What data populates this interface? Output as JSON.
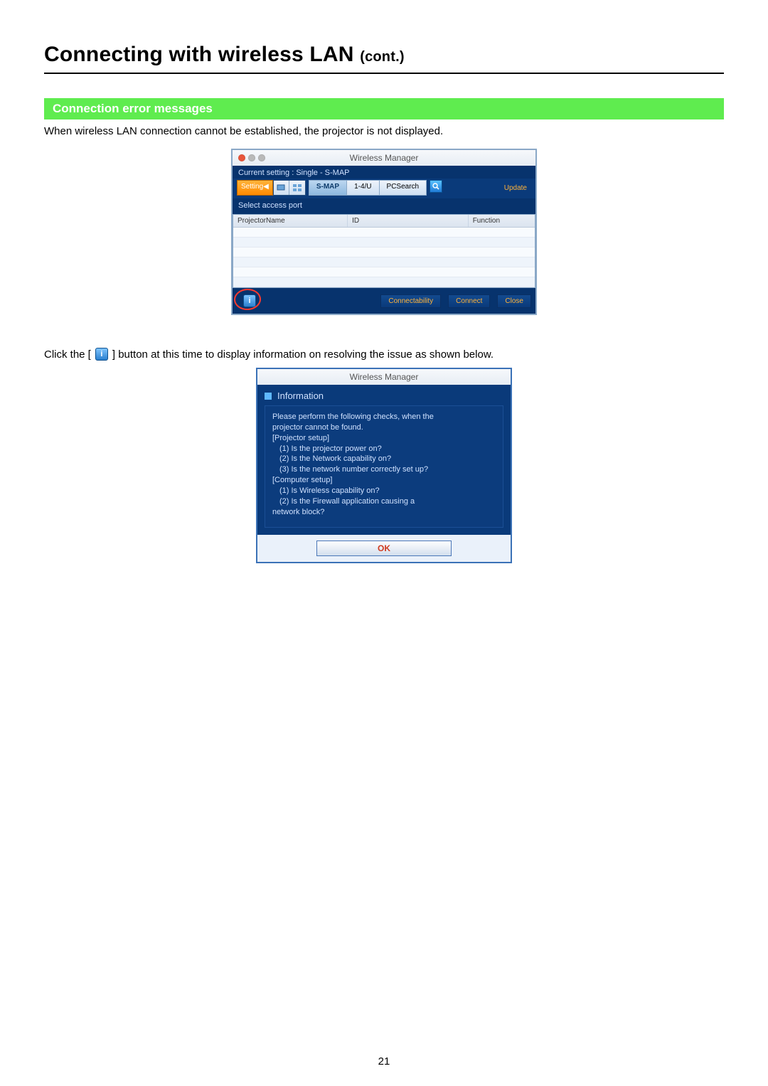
{
  "page": {
    "title_main": "Connecting with wireless LAN",
    "title_cont": "(cont.)",
    "section_header": "Connection error messages",
    "intro_text": "When wireless LAN connection cannot be established, the projector is not displayed.",
    "click_line_pre": "Click the [",
    "click_line_post": "] button at this time to display information on resolving the issue as shown below.",
    "page_number": "21"
  },
  "wm_window": {
    "title": "Wireless Manager",
    "current_setting": "Current setting : Single - S-MAP",
    "setting_btn": "Setting",
    "tabs": {
      "smap": "S-MAP",
      "one_four_u": "1-4/U",
      "pcsearch": "PCSearch"
    },
    "update": "Update",
    "select_access_port": "Select access port",
    "columns": {
      "name": "ProjectorName",
      "id": "ID",
      "func": "Function"
    },
    "info_btn_label": "i",
    "connectability": "Connectability",
    "connect": "Connect",
    "close": "Close"
  },
  "info_dialog": {
    "title": "Wireless Manager",
    "header": "Information",
    "lines": {
      "l1": "Please perform the following checks, when the",
      "l2": "projector cannot  be found.",
      "l3": "[Projector setup]",
      "l4": "(1) Is the projector power on?",
      "l5": "(2) Is the Network capability on?",
      "l6": "(3) Is the network number correctly set up?",
      "l7": "[Computer setup]",
      "l8": "(1) Is Wireless capability on?",
      "l9": "(2) Is the Firewall application causing a",
      "l10": "network block?"
    },
    "ok": "OK"
  }
}
